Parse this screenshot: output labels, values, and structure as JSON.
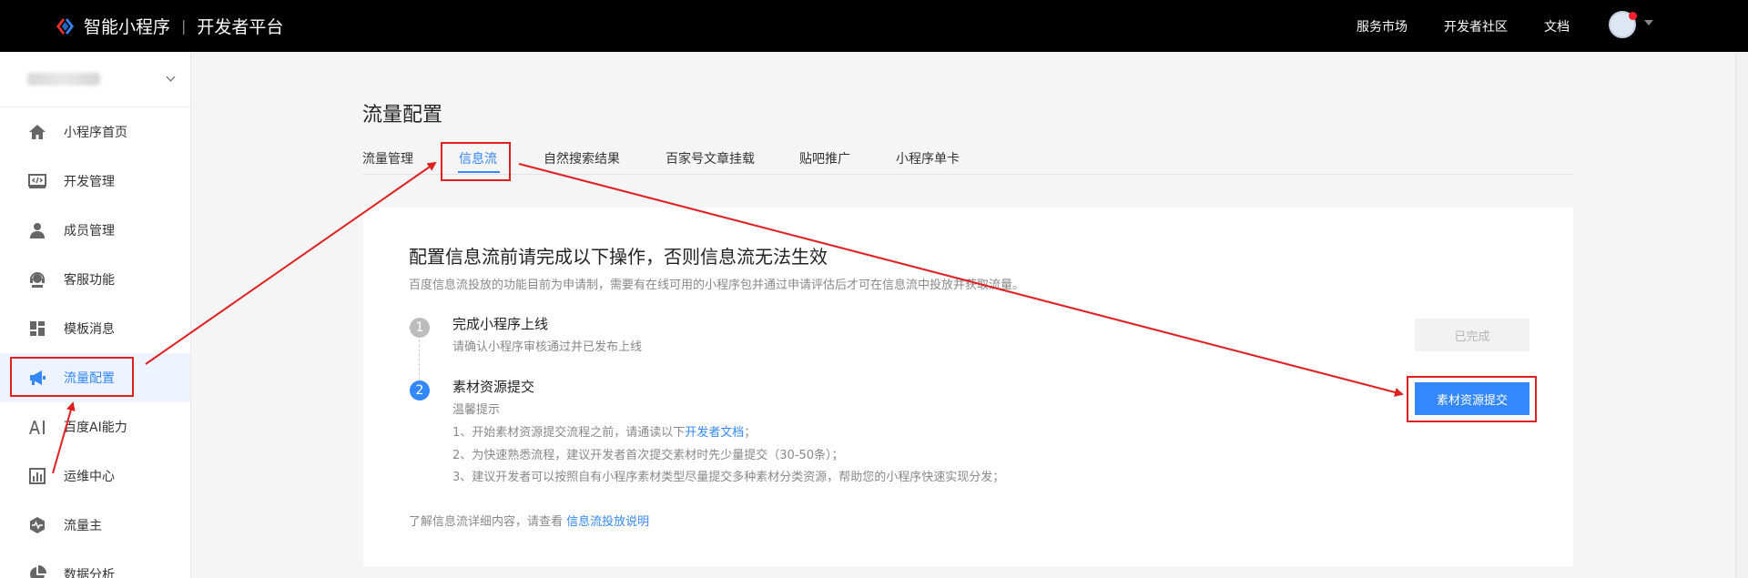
{
  "header": {
    "brand_name": "智能小程序",
    "platform_name": "开发者平台",
    "nav": [
      "服务市场",
      "开发者社区",
      "文档"
    ]
  },
  "sidebar": {
    "items": [
      {
        "label": "小程序首页",
        "icon": "home-icon"
      },
      {
        "label": "开发管理",
        "icon": "code-icon"
      },
      {
        "label": "成员管理",
        "icon": "user-icon"
      },
      {
        "label": "客服功能",
        "icon": "headset-icon"
      },
      {
        "label": "模板消息",
        "icon": "template-icon"
      },
      {
        "label": "流量配置",
        "icon": "megaphone-icon",
        "active": true
      },
      {
        "label": "百度AI能力",
        "icon": "ai-icon"
      },
      {
        "label": "运维中心",
        "icon": "chart-icon"
      },
      {
        "label": "流量主",
        "icon": "pulse-icon"
      },
      {
        "label": "数据分析",
        "icon": "pie-icon"
      }
    ]
  },
  "main": {
    "title": "流量配置",
    "tabs": [
      "流量管理",
      "信息流",
      "自然搜索结果",
      "百家号文章挂载",
      "贴吧推广",
      "小程序单卡"
    ],
    "active_tab": "信息流"
  },
  "card": {
    "title": "配置信息流前请完成以下操作，否则信息流无法生效",
    "desc": "百度信息流投放的功能目前为申请制，需要有在线可用的小程序包并通过申请评估后才可在信息流中投放并获取流量。",
    "step1": {
      "num": "1",
      "title": "完成小程序上线",
      "sub": "请确认小程序审核通过并已发布上线",
      "button": "已完成"
    },
    "step2": {
      "num": "2",
      "title": "素材资源提交",
      "tip_label": "温馨提示",
      "tip1_prefix": "1、开始素材资源提交流程之前，请通读以下",
      "tip1_link": "开发者文档",
      "tip1_suffix": "；",
      "tip2": "2、为快速熟悉流程，建议开发者首次提交素材时先少量提交（30-50条）；",
      "tip3": "3、建议开发者可以按照自有小程序素材类型尽量提交多种素材分类资源，帮助您的小程序快速实现分发；",
      "button": "素材资源提交"
    },
    "footnote_prefix": "了解信息流详细内容，请查看 ",
    "footnote_link": "信息流投放说明"
  },
  "colors": {
    "accent": "#3388ff",
    "annotation": "#e02020",
    "header_bg": "#000000"
  }
}
